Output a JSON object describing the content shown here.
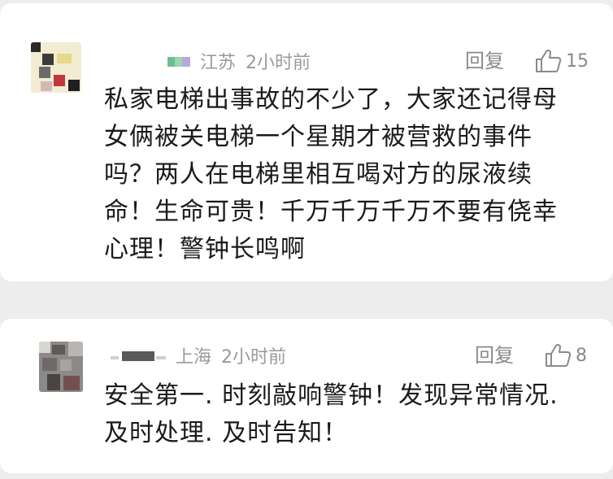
{
  "comments": [
    {
      "location": "江苏",
      "time": "2小时前",
      "reply_label": "回复",
      "like_count": "15",
      "text": "私家电梯出事故的不少了，大家还记得母女俩被关电梯一个星期才被营救的事件吗？两人在电梯里相互喝对方的尿液续命！生命可贵！千万千万千万不要有侥幸心理！警钟长鸣啊"
    },
    {
      "location": "上海",
      "time": "2小时前",
      "reply_label": "回复",
      "like_count": "8",
      "text": "安全第一. 时刻敲响警钟！发现异常情况. 及时处理. 及时告知！"
    }
  ],
  "icons": {
    "like": "thumbs-up-icon"
  },
  "colors": {
    "meta_text": "#9a9a9a",
    "content_text": "#1a1a1a",
    "card_bg": "#ffffff",
    "page_bg": "#ededed"
  }
}
